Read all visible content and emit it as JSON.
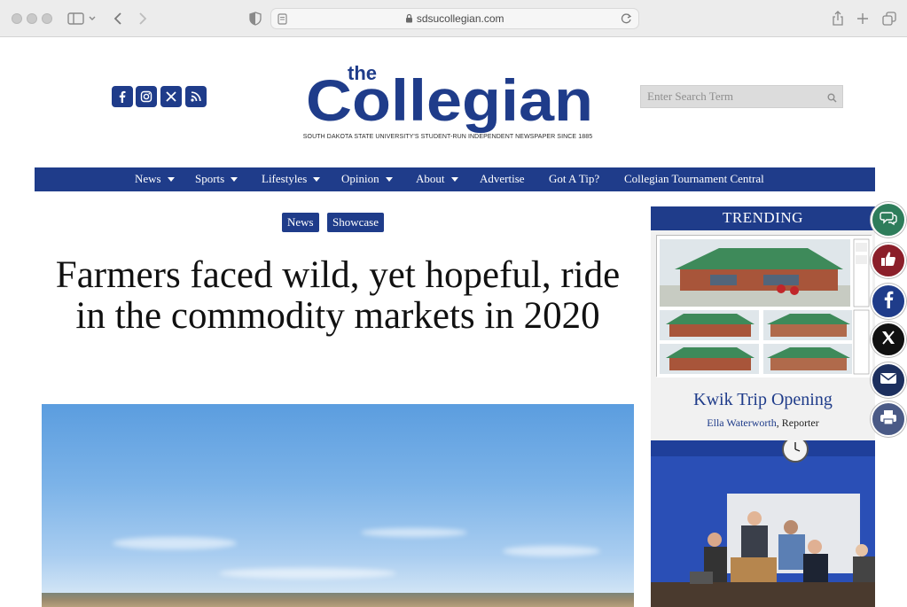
{
  "browser": {
    "url": "sdsucollegian.com"
  },
  "header": {
    "logo_small": "the",
    "logo_text": "Collegian",
    "tagline": "SOUTH DAKOTA STATE UNIVERSITY'S STUDENT-RUN INDEPENDENT NEWSPAPER SINCE 1885",
    "search_placeholder": "Enter Search Term",
    "social_icons": [
      "facebook-icon",
      "instagram-icon",
      "x-icon",
      "rss-icon"
    ]
  },
  "nav": {
    "items": [
      {
        "label": "News",
        "dropdown": true
      },
      {
        "label": "Sports",
        "dropdown": true
      },
      {
        "label": "Lifestyles",
        "dropdown": true
      },
      {
        "label": "Opinion",
        "dropdown": true
      },
      {
        "label": "About",
        "dropdown": true
      },
      {
        "label": "Advertise",
        "dropdown": false
      },
      {
        "label": "Got A Tip?",
        "dropdown": false
      },
      {
        "label": "Collegian Tournament Central",
        "dropdown": false
      }
    ]
  },
  "article": {
    "tags": [
      "News",
      "Showcase"
    ],
    "headline": "Farmers faced wild, yet hopeful, ride in the commodity markets in 2020"
  },
  "sidebar": {
    "heading": "TRENDING",
    "story_title": "Kwik Trip Opening",
    "story_author": "Ella Waterworth",
    "story_role": ", Reporter"
  },
  "share_buttons": [
    "comment-icon",
    "like-icon",
    "facebook-icon",
    "x-icon",
    "email-icon",
    "print-icon"
  ],
  "colors": {
    "brand": "#1f3c8a",
    "comment": "#2e7d5b",
    "like": "#8b1f2a",
    "facebook": "#1f3c8a",
    "x": "#111111",
    "email": "#1c2f5e",
    "print": "#4a5a86"
  }
}
